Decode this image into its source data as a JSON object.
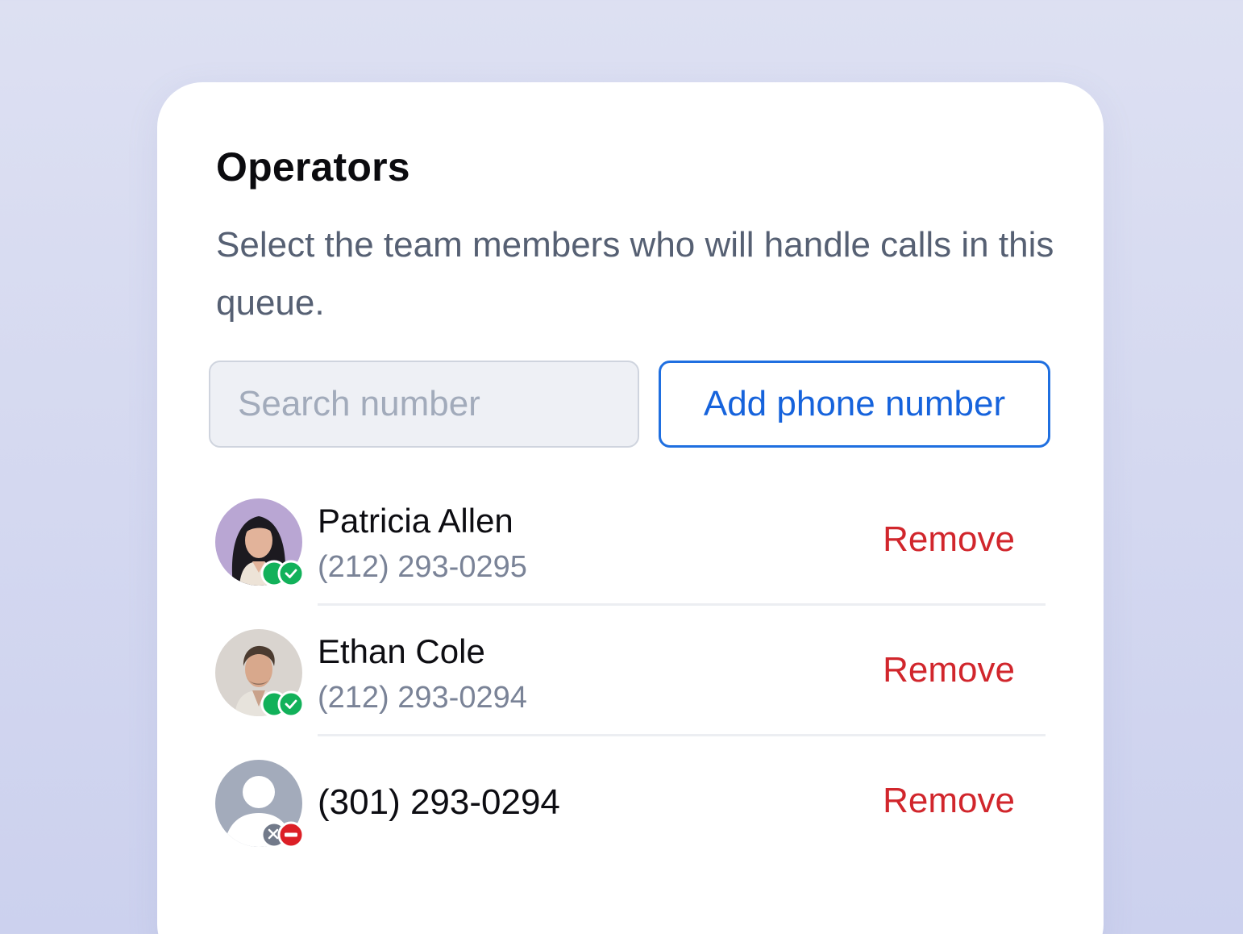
{
  "panel": {
    "title": "Operators",
    "description": "Select the team members who will handle calls in this queue."
  },
  "search": {
    "placeholder": "Search number",
    "dropdown_icon": "chevron-down-icon"
  },
  "add_button": {
    "label": "Add phone number"
  },
  "operators": [
    {
      "name": "Patricia Allen",
      "phone": "(212) 293-0295",
      "status": "active",
      "action": "Remove"
    },
    {
      "name": "Ethan Cole",
      "phone": "(212) 293-0294",
      "status": "active",
      "action": "Remove"
    },
    {
      "name": "",
      "phone": "(301) 293-0294",
      "status": "inactive",
      "action": "Remove"
    }
  ],
  "colors": {
    "accent_blue": "#1663dc",
    "remove_red": "#d1262c",
    "status_green": "#12b15a",
    "status_red": "#dc1f26"
  }
}
